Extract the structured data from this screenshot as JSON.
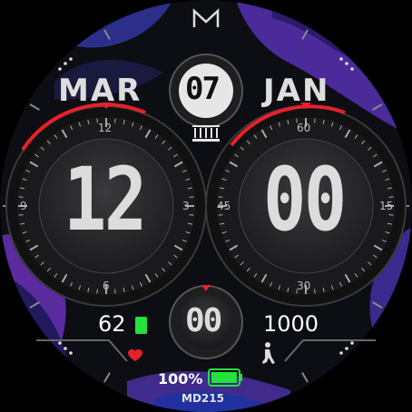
{
  "brand": {
    "logo_letter": "M",
    "model": "MD215"
  },
  "date": {
    "month": "MAR",
    "day": "07",
    "day_of_week": "JAN"
  },
  "time": {
    "hours": "12",
    "minutes": "00",
    "seconds": "00"
  },
  "left_dial": {
    "ticks": [
      "12",
      "3",
      "6",
      "9"
    ]
  },
  "right_dial": {
    "ticks": [
      "60",
      "15",
      "30",
      "45"
    ]
  },
  "heart_rate": {
    "value": "62"
  },
  "steps": {
    "value": "1000"
  },
  "battery": {
    "percent_text": "100%",
    "level": 1.0
  },
  "colors": {
    "accent_red": "#e8202a",
    "battery_green": "#23e23a",
    "camo_purple": "#5a2a9e",
    "camo_blue": "#1e3a9a",
    "dial_bg": "#2a2a2c"
  }
}
